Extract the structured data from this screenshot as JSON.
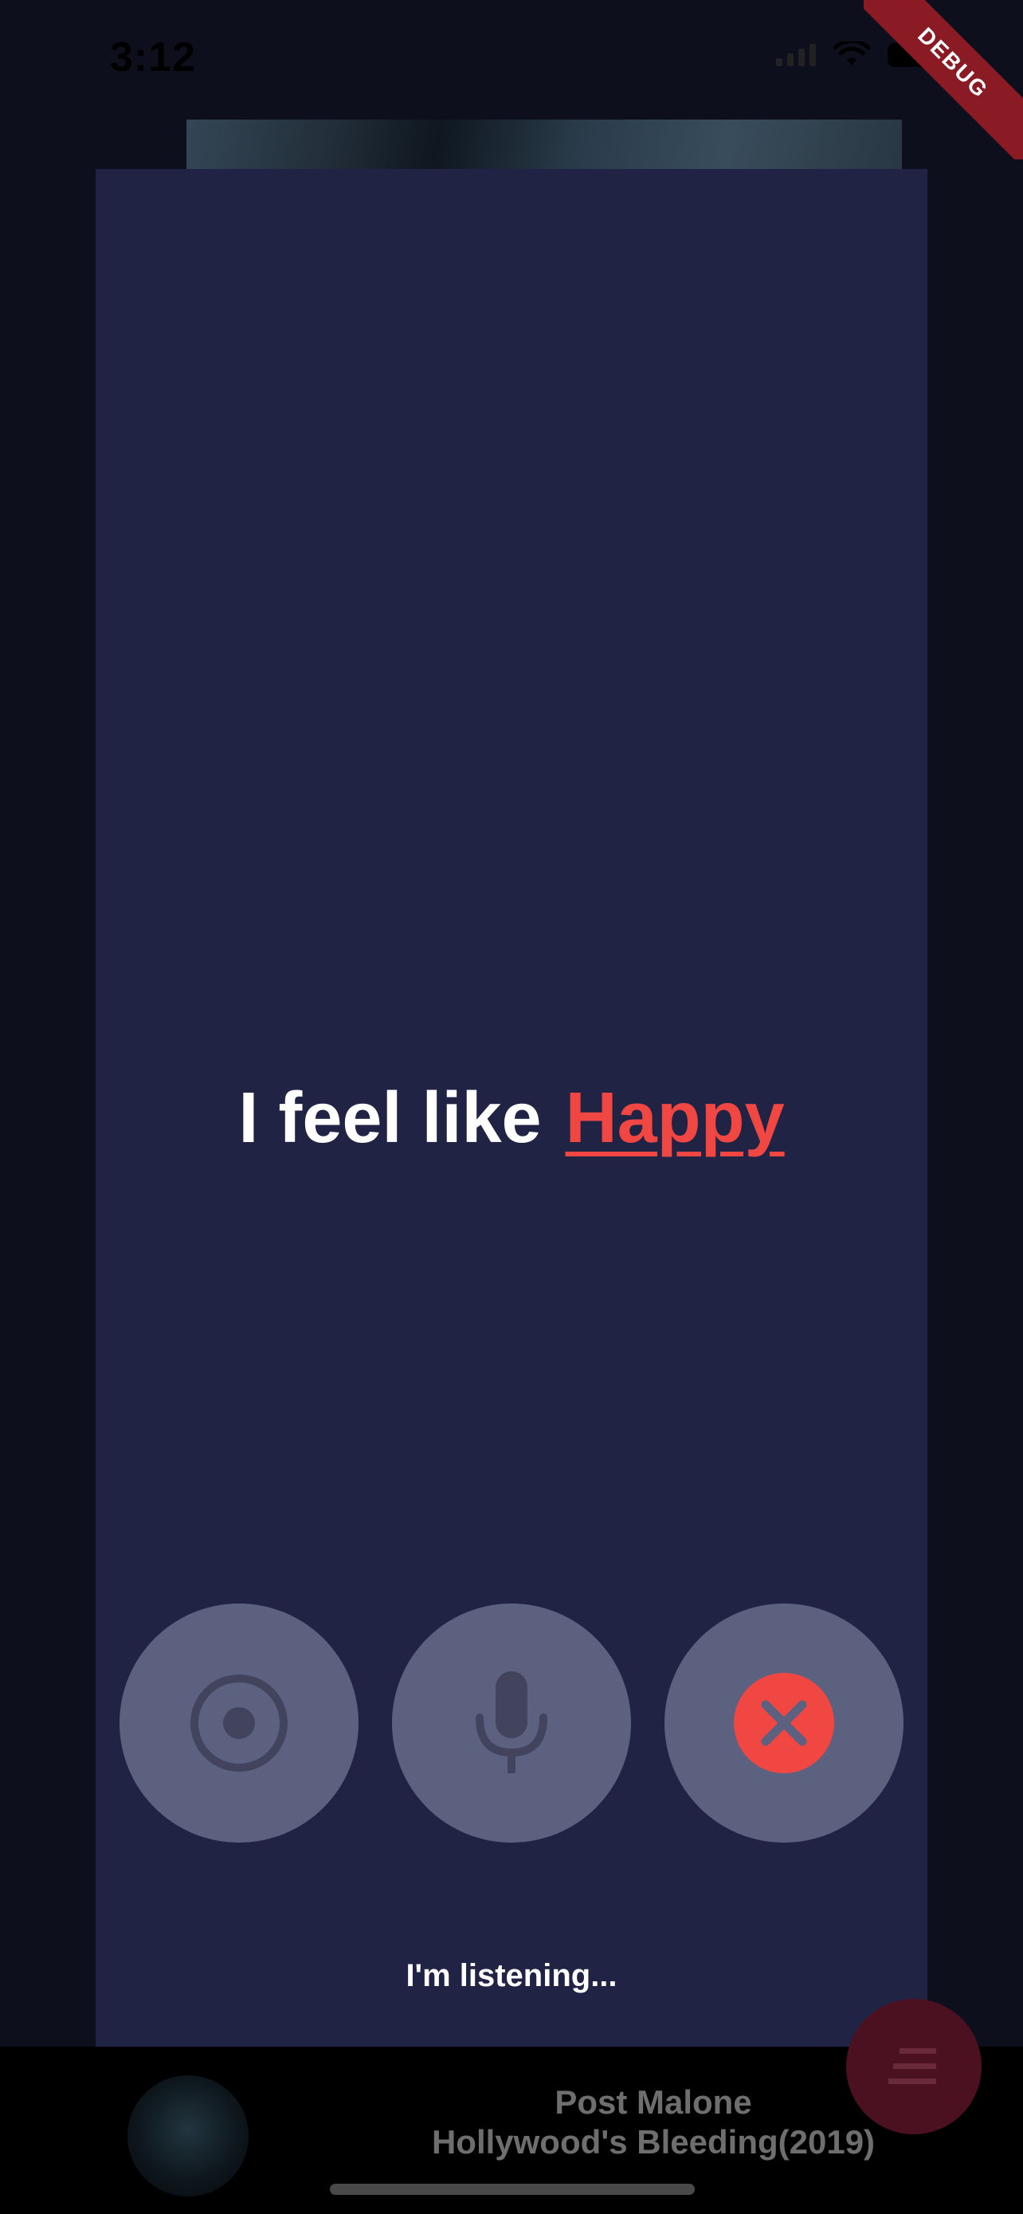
{
  "status_bar": {
    "time": "3:12"
  },
  "debug_banner": {
    "label": "DEBUG"
  },
  "voice_modal": {
    "prompt": "I feel like",
    "mood": "Happy",
    "status": "I'm listening...",
    "buttons": {
      "record": "record-icon",
      "mic": "mic-icon",
      "cancel": "close-icon"
    }
  },
  "player": {
    "artist": "Post Malone",
    "album": "Hollywood's Bleeding(2019)"
  },
  "fab": {
    "icon": "menu-icon"
  },
  "colors": {
    "panel": "#212345",
    "accent": "#f04742",
    "button": "#5d6180"
  }
}
